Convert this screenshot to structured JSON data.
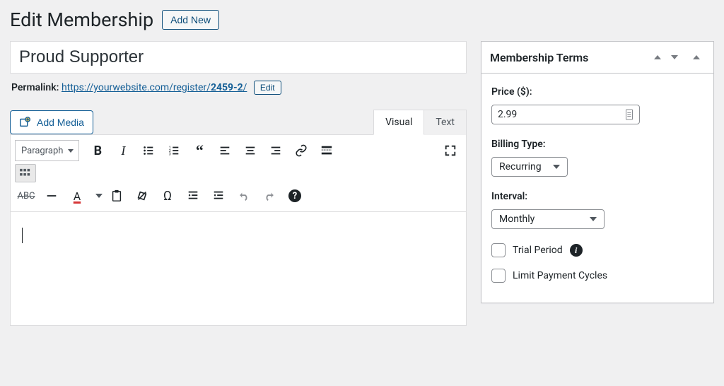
{
  "header": {
    "title": "Edit Membership",
    "add_new_label": "Add New"
  },
  "post": {
    "title_value": "Proud Supporter",
    "permalink_label": "Permalink:",
    "permalink_base": "https://yourwebsite.com/register/",
    "permalink_slug": "2459-2",
    "permalink_edit_label": "Edit"
  },
  "editor": {
    "add_media_label": "Add Media",
    "tabs": {
      "visual": "Visual",
      "text": "Text"
    },
    "format_label": "Paragraph"
  },
  "sidebar": {
    "panel_title": "Membership Terms",
    "price_label": "Price ($):",
    "price_value": "2.99",
    "billing_label": "Billing Type:",
    "billing_value": "Recurring",
    "interval_label": "Interval:",
    "interval_value": "Monthly",
    "trial_label": "Trial Period",
    "limit_label": "Limit Payment Cycles"
  }
}
